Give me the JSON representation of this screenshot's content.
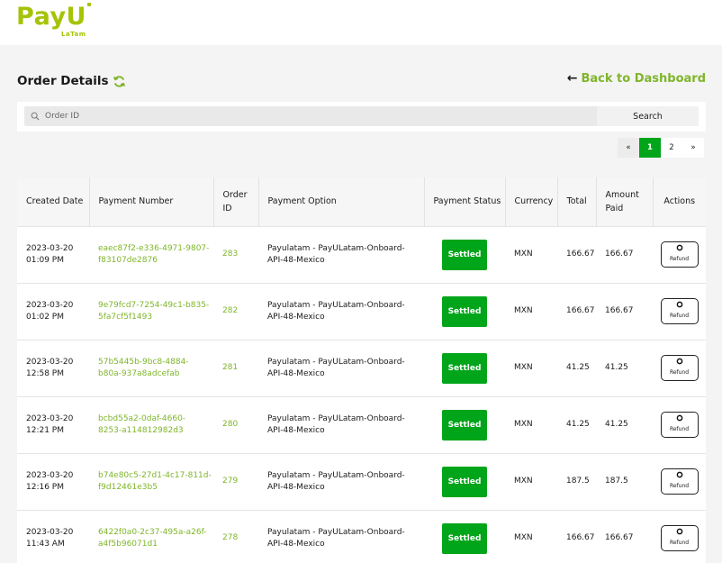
{
  "brand": {
    "name": "PayU",
    "sub": "LaTam",
    "color": "#a6c307"
  },
  "page": {
    "title": "Order Details",
    "back_label": "Back to Dashboard"
  },
  "search": {
    "placeholder": "Order ID",
    "value": "",
    "button_label": "Search"
  },
  "pagination": {
    "prev": "«",
    "pages": [
      "1",
      "2"
    ],
    "current": "1",
    "next": "»"
  },
  "table": {
    "headers": [
      "Created Date",
      "Payment Number",
      "Order ID",
      "Payment Option",
      "Payment Status",
      "Currency",
      "Total",
      "Amount Paid",
      "Actions"
    ],
    "rows": [
      {
        "date": "2023-03-20",
        "time": "01:09 PM",
        "payment_number_1": "eaec87f2-e336-4971-9807-",
        "payment_number_2": "f83107de2876",
        "order_id": "283",
        "option_1": "Payulatam - PayULatam-Onboard-",
        "option_2": "API-48-Mexico",
        "status": "Settled",
        "currency": "MXN",
        "total": "166.67",
        "paid": "166.67",
        "action": "Refund"
      },
      {
        "date": "2023-03-20",
        "time": "01:02 PM",
        "payment_number_1": "9e79fcd7-7254-49c1-b835-",
        "payment_number_2": "5fa7cf5f1493",
        "order_id": "282",
        "option_1": "Payulatam - PayULatam-Onboard-",
        "option_2": "API-48-Mexico",
        "status": "Settled",
        "currency": "MXN",
        "total": "166.67",
        "paid": "166.67",
        "action": "Refund"
      },
      {
        "date": "2023-03-20",
        "time": "12:58 PM",
        "payment_number_1": "57b5445b-9bc8-4884-",
        "payment_number_2": "b80a-937a8adcefab",
        "order_id": "281",
        "option_1": "Payulatam - PayULatam-Onboard-",
        "option_2": "API-48-Mexico",
        "status": "Settled",
        "currency": "MXN",
        "total": "41.25",
        "paid": "41.25",
        "action": "Refund"
      },
      {
        "date": "2023-03-20",
        "time": "12:21 PM",
        "payment_number_1": "bcbd55a2-0daf-4660-",
        "payment_number_2": "8253-a114812982d3",
        "order_id": "280",
        "option_1": "Payulatam - PayULatam-Onboard-",
        "option_2": "API-48-Mexico",
        "status": "Settled",
        "currency": "MXN",
        "total": "41.25",
        "paid": "41.25",
        "action": "Refund"
      },
      {
        "date": "2023-03-20",
        "time": "12:16 PM",
        "payment_number_1": "b74e80c5-27d1-4c17-811d-",
        "payment_number_2": "f9d12461e3b5",
        "order_id": "279",
        "option_1": "Payulatam - PayULatam-Onboard-",
        "option_2": "API-48-Mexico",
        "status": "Settled",
        "currency": "MXN",
        "total": "187.5",
        "paid": "187.5",
        "action": "Refund"
      },
      {
        "date": "2023-03-20",
        "time": "11:43 AM",
        "payment_number_1": "6422f0a0-2c37-495a-a26f-",
        "payment_number_2": "a4f5b96071d1",
        "order_id": "278",
        "option_1": "Payulatam - PayULatam-Onboard-",
        "option_2": "API-48-Mexico",
        "status": "Settled",
        "currency": "MXN",
        "total": "166.67",
        "paid": "166.67",
        "action": "Refund"
      }
    ]
  },
  "colors": {
    "accent": "#7fb52a",
    "settled": "#00a51a"
  }
}
